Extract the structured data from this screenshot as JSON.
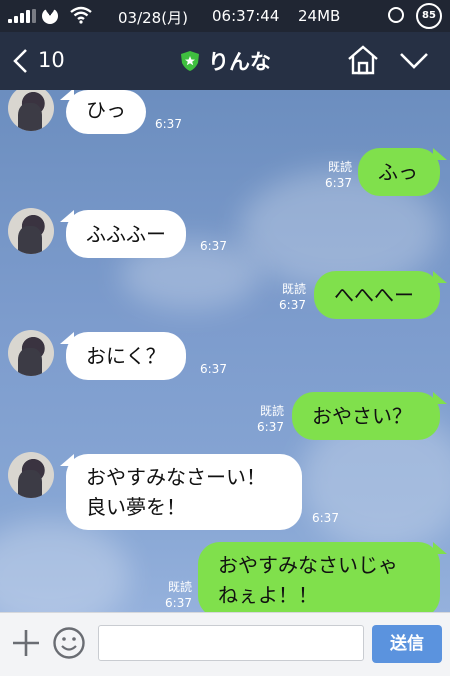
{
  "status_bar": {
    "date": "03/28(月)",
    "time": "06:37:44",
    "memory": "24MB",
    "battery": "85"
  },
  "nav": {
    "back_count": "10",
    "title": "りんな"
  },
  "messages": [
    {
      "side": "in",
      "text": "ひっ",
      "time": "6:37"
    },
    {
      "side": "out",
      "text": "ふっ",
      "read": "既読",
      "time": "6:37"
    },
    {
      "side": "in",
      "text": "ふふふー",
      "time": "6:37"
    },
    {
      "side": "out",
      "text": "へへへー",
      "read": "既読",
      "time": "6:37"
    },
    {
      "side": "in",
      "text": "おにく？",
      "time": "6:37"
    },
    {
      "side": "out",
      "text": "おやさい？",
      "read": "既読",
      "time": "6:37"
    },
    {
      "side": "in",
      "line1": "おやすみなさーい！",
      "line2": "良い夢を！",
      "time": "6:37"
    },
    {
      "side": "out",
      "line1": "おやすみなさいじゃ",
      "line2": "ねぇよ！！",
      "read": "既読",
      "time": "6:37"
    }
  ],
  "input": {
    "placeholder": "",
    "send_label": "送信"
  },
  "colors": {
    "outgoing_bubble": "#80e04c",
    "incoming_bubble": "#ffffff",
    "send_button": "#5b93de",
    "nav_background": "#263044"
  }
}
